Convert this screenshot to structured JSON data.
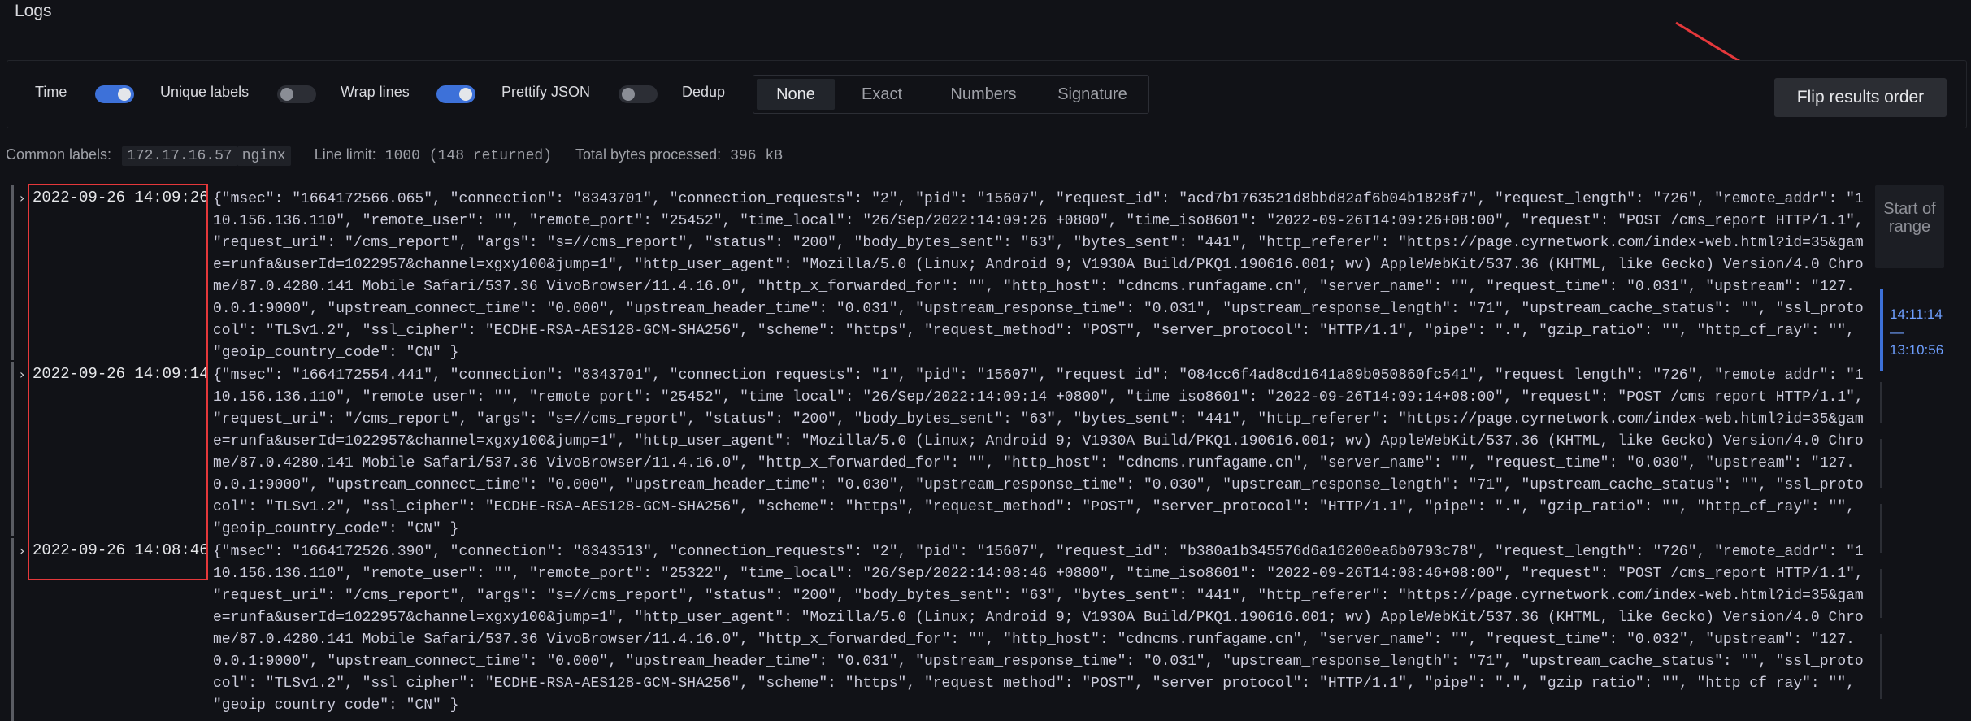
{
  "page": {
    "title": "Logs"
  },
  "options": {
    "time": {
      "label": "Time",
      "on": true
    },
    "unique_labels": {
      "label": "Unique labels",
      "on": false
    },
    "wrap_lines": {
      "label": "Wrap lines",
      "on": true
    },
    "prettify_json": {
      "label": "Prettify JSON",
      "on": false
    },
    "dedup": {
      "label": "Dedup",
      "options": [
        "None",
        "Exact",
        "Numbers",
        "Signature"
      ],
      "selected": "None"
    }
  },
  "flip_button": {
    "label": "Flip results order"
  },
  "summary": {
    "common_labels_label": "Common labels:",
    "common_labels": [
      "172.17.16.57",
      "nginx"
    ],
    "line_limit_label": "Line limit:",
    "line_limit_value": "1000 (148 returned)",
    "bytes_label": "Total bytes processed:",
    "bytes_value": "396 kB"
  },
  "logs": [
    {
      "timestamp": "2022-09-26 14:09:26",
      "line": "{\"msec\": \"1664172566.065\", \"connection\": \"8343701\", \"connection_requests\": \"2\", \"pid\": \"15607\", \"request_id\": \"acd7b1763521d8bbd82af6b04b1828f7\", \"request_length\": \"726\", \"remote_addr\": \"110.156.136.110\", \"remote_user\": \"\", \"remote_port\": \"25452\", \"time_local\": \"26/Sep/2022:14:09:26 +0800\", \"time_iso8601\": \"2022-09-26T14:09:26+08:00\", \"request\": \"POST /cms_report HTTP/1.1\", \"request_uri\": \"/cms_report\", \"args\": \"s=//cms_report\", \"status\": \"200\", \"body_bytes_sent\": \"63\", \"bytes_sent\": \"441\", \"http_referer\": \"https://page.cyrnetwork.com/index-web.html?id=35&game=runfa&userId=1022957&channel=xgxy100&jump=1\", \"http_user_agent\": \"Mozilla/5.0 (Linux; Android 9; V1930A Build/PKQ1.190616.001; wv) AppleWebKit/537.36 (KHTML, like Gecko) Version/4.0 Chrome/87.0.4280.141 Mobile Safari/537.36 VivoBrowser/11.4.16.0\", \"http_x_forwarded_for\": \"\", \"http_host\": \"cdncms.runfagame.cn\", \"server_name\": \"\", \"request_time\": \"0.031\", \"upstream\": \"127.0.0.1:9000\", \"upstream_connect_time\": \"0.000\", \"upstream_header_time\": \"0.031\", \"upstream_response_time\": \"0.031\", \"upstream_response_length\": \"71\", \"upstream_cache_status\": \"\", \"ssl_protocol\": \"TLSv1.2\", \"ssl_cipher\": \"ECDHE-RSA-AES128-GCM-SHA256\", \"scheme\": \"https\", \"request_method\": \"POST\", \"server_protocol\": \"HTTP/1.1\", \"pipe\": \".\", \"gzip_ratio\": \"\", \"http_cf_ray\": \"\", \"geoip_country_code\": \"CN\" }"
    },
    {
      "timestamp": "2022-09-26 14:09:14",
      "line": "{\"msec\": \"1664172554.441\", \"connection\": \"8343701\", \"connection_requests\": \"1\", \"pid\": \"15607\", \"request_id\": \"084cc6f4ad8cd1641a89b050860fc541\", \"request_length\": \"726\", \"remote_addr\": \"110.156.136.110\", \"remote_user\": \"\", \"remote_port\": \"25452\", \"time_local\": \"26/Sep/2022:14:09:14 +0800\", \"time_iso8601\": \"2022-09-26T14:09:14+08:00\", \"request\": \"POST /cms_report HTTP/1.1\", \"request_uri\": \"/cms_report\", \"args\": \"s=//cms_report\", \"status\": \"200\", \"body_bytes_sent\": \"63\", \"bytes_sent\": \"441\", \"http_referer\": \"https://page.cyrnetwork.com/index-web.html?id=35&game=runfa&userId=1022957&channel=xgxy100&jump=1\", \"http_user_agent\": \"Mozilla/5.0 (Linux; Android 9; V1930A Build/PKQ1.190616.001; wv) AppleWebKit/537.36 (KHTML, like Gecko) Version/4.0 Chrome/87.0.4280.141 Mobile Safari/537.36 VivoBrowser/11.4.16.0\", \"http_x_forwarded_for\": \"\", \"http_host\": \"cdncms.runfagame.cn\", \"server_name\": \"\", \"request_time\": \"0.030\", \"upstream\": \"127.0.0.1:9000\", \"upstream_connect_time\": \"0.000\", \"upstream_header_time\": \"0.030\", \"upstream_response_time\": \"0.030\", \"upstream_response_length\": \"71\", \"upstream_cache_status\": \"\", \"ssl_protocol\": \"TLSv1.2\", \"ssl_cipher\": \"ECDHE-RSA-AES128-GCM-SHA256\", \"scheme\": \"https\", \"request_method\": \"POST\", \"server_protocol\": \"HTTP/1.1\", \"pipe\": \".\", \"gzip_ratio\": \"\", \"http_cf_ray\": \"\", \"geoip_country_code\": \"CN\" }"
    },
    {
      "timestamp": "2022-09-26 14:08:46",
      "line": "{\"msec\": \"1664172526.390\", \"connection\": \"8343513\", \"connection_requests\": \"2\", \"pid\": \"15607\", \"request_id\": \"b380a1b345576d6a16200ea6b0793c78\", \"request_length\": \"726\", \"remote_addr\": \"110.156.136.110\", \"remote_user\": \"\", \"remote_port\": \"25322\", \"time_local\": \"26/Sep/2022:14:08:46 +0800\", \"time_iso8601\": \"2022-09-26T14:08:46+08:00\", \"request\": \"POST /cms_report HTTP/1.1\", \"request_uri\": \"/cms_report\", \"args\": \"s=//cms_report\", \"status\": \"200\", \"body_bytes_sent\": \"63\", \"bytes_sent\": \"441\", \"http_referer\": \"https://page.cyrnetwork.com/index-web.html?id=35&game=runfa&userId=1022957&channel=xgxy100&jump=1\", \"http_user_agent\": \"Mozilla/5.0 (Linux; Android 9; V1930A Build/PKQ1.190616.001; wv) AppleWebKit/537.36 (KHTML, like Gecko) Version/4.0 Chrome/87.0.4280.141 Mobile Safari/537.36 VivoBrowser/11.4.16.0\", \"http_x_forwarded_for\": \"\", \"http_host\": \"cdncms.runfagame.cn\", \"server_name\": \"\", \"request_time\": \"0.032\", \"upstream\": \"127.0.0.1:9000\", \"upstream_connect_time\": \"0.000\", \"upstream_header_time\": \"0.031\", \"upstream_response_time\": \"0.031\", \"upstream_response_length\": \"71\", \"upstream_cache_status\": \"\", \"ssl_protocol\": \"TLSv1.2\", \"ssl_cipher\": \"ECDHE-RSA-AES128-GCM-SHA256\", \"scheme\": \"https\", \"request_method\": \"POST\", \"server_protocol\": \"HTTP/1.1\", \"pipe\": \".\", \"gzip_ratio\": \"\", \"http_cf_ray\": \"\", \"geoip_country_code\": \"CN\" }"
    }
  ],
  "range_panel": {
    "start_label": "Start of range",
    "range_from": "14:11:14",
    "range_sep": "—",
    "range_to": "13:10:56"
  },
  "colors": {
    "accent": "#3d71d9",
    "highlight_box": "#e5383b",
    "annotation_arrow": "#e5383b"
  }
}
